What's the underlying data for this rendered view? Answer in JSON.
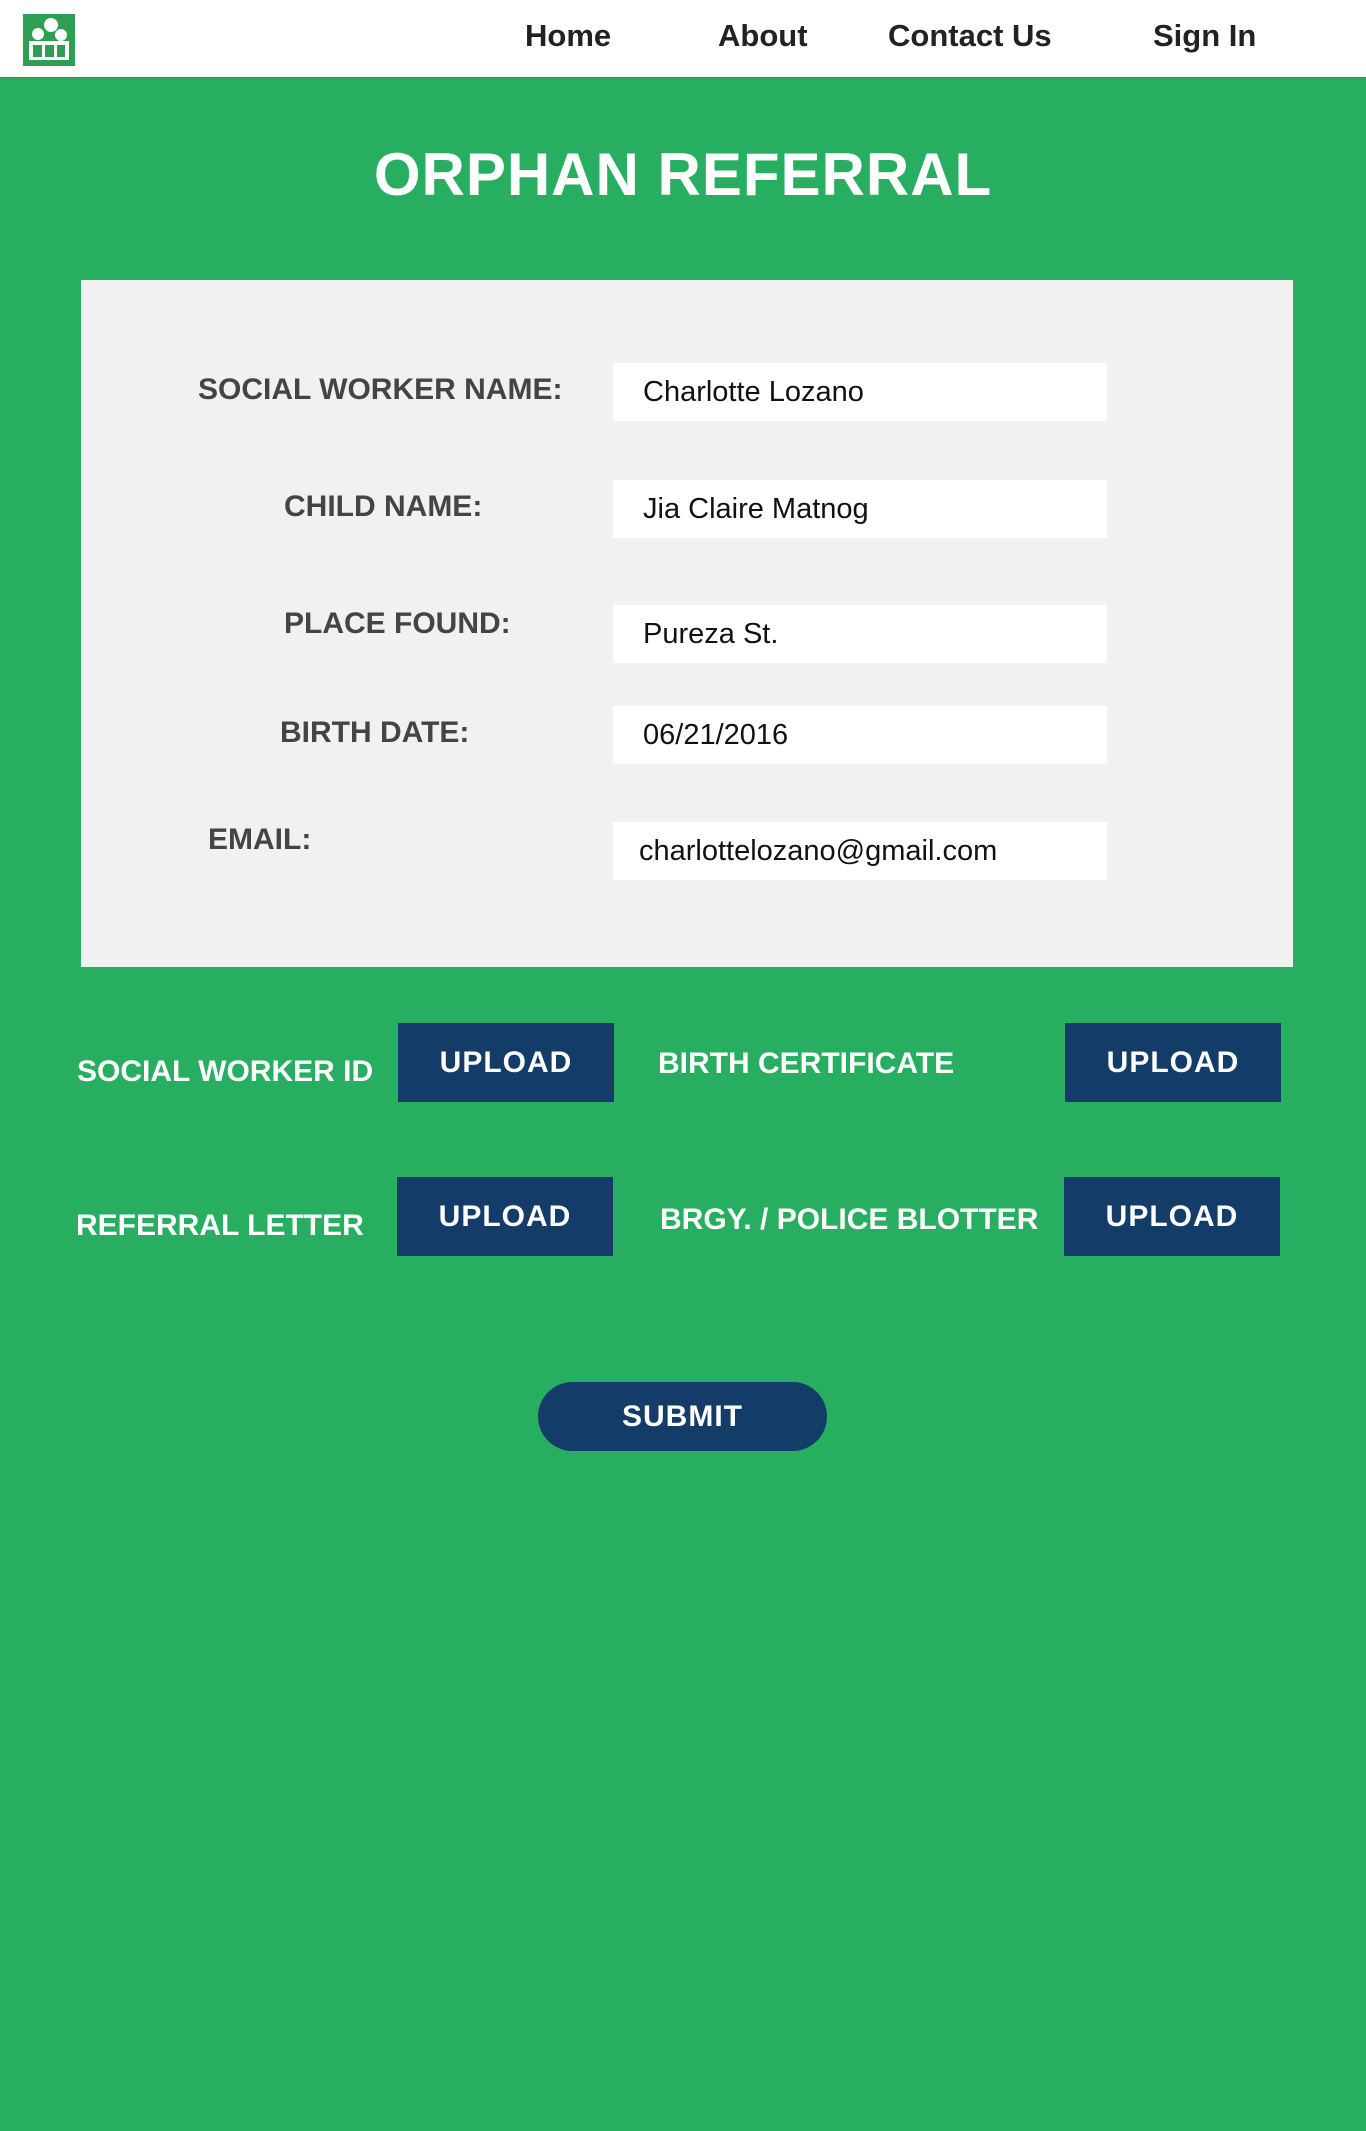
{
  "nav": {
    "items": [
      {
        "label": "Home"
      },
      {
        "label": "About"
      },
      {
        "label": "Contact Us"
      },
      {
        "label": "Sign In"
      }
    ]
  },
  "logo": {
    "icon": "family-logo-icon"
  },
  "page": {
    "title": "ORPHAN REFERRAL"
  },
  "form": {
    "fields": [
      {
        "label": "SOCIAL WORKER NAME:",
        "value": "Charlotte Lozano"
      },
      {
        "label": "CHILD NAME:",
        "value": "Jia Claire Matnog"
      },
      {
        "label": "PLACE FOUND:",
        "value": "Pureza St."
      },
      {
        "label": "BIRTH DATE:",
        "value": "06/21/2016"
      },
      {
        "label": "EMAIL:",
        "value": "charlottelozano@gmail.com"
      }
    ]
  },
  "uploads": [
    {
      "label": "SOCIAL WORKER ID",
      "button": "UPLOAD"
    },
    {
      "label": "BIRTH CERTIFICATE",
      "button": "UPLOAD"
    },
    {
      "label": "REFERRAL LETTER",
      "button": "UPLOAD"
    },
    {
      "label": "BRGY. / POLICE BLOTTER",
      "button": "UPLOAD"
    }
  ],
  "submit": {
    "label": "SUBMIT"
  },
  "colors": {
    "background": "#27ae60",
    "button": "#143c68",
    "card": "#f1f1f1",
    "label": "#444444"
  }
}
